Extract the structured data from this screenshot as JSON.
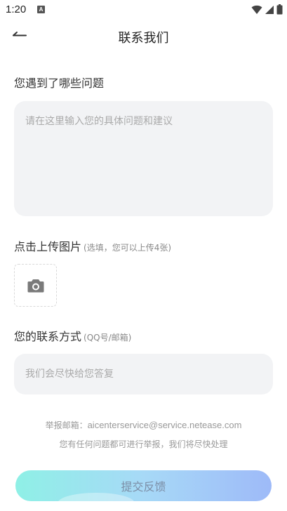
{
  "status_bar": {
    "time": "1:20",
    "notification_badge": "A"
  },
  "header": {
    "title": "联系我们"
  },
  "problem_section": {
    "label": "您遇到了哪些问题",
    "placeholder": "请在这里输入您的具体问题和建议",
    "value": ""
  },
  "upload_section": {
    "label": "点击上传图片",
    "hint": "(选填，您可以上传4张)",
    "icon": "camera-icon"
  },
  "contact_section": {
    "label": "您的联系方式",
    "hint": "(QQ号/邮箱)",
    "placeholder": "我们会尽快给您答复",
    "value": ""
  },
  "report": {
    "email_prefix": "举报邮箱：",
    "email": "aicenterservice@service.netease.com",
    "note": "您有任何问题都可进行举报，我们将尽快处理"
  },
  "submit": {
    "label": "提交反馈"
  },
  "colors": {
    "input_bg": "#f2f3f5",
    "submit_gradient_start": "#8ff0e6",
    "submit_gradient_end": "#9ebaf8",
    "muted_text": "#999999"
  }
}
